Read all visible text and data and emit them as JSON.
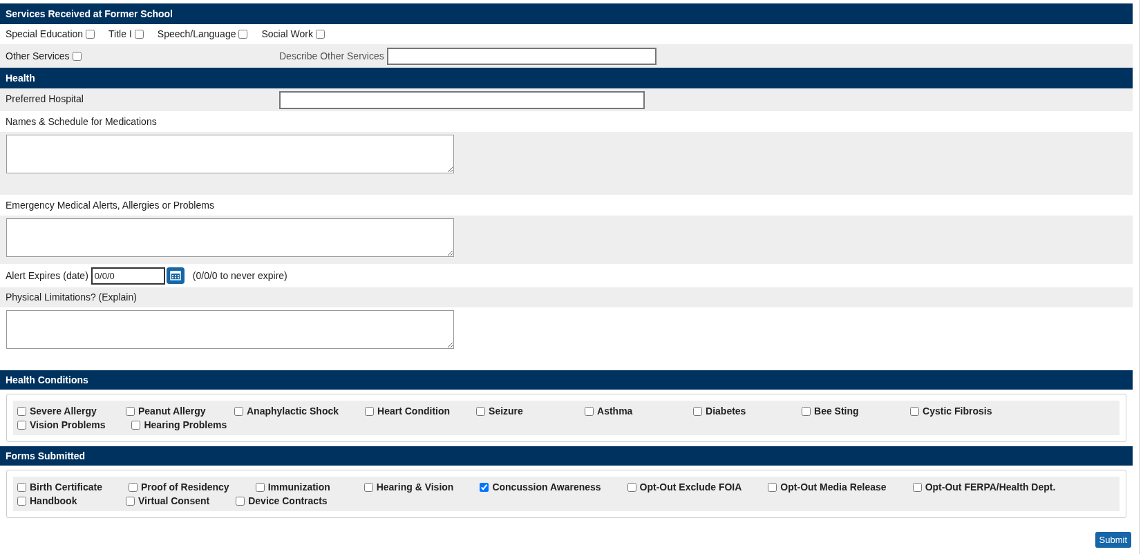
{
  "services": {
    "title": "Services Received at Former School",
    "options": [
      {
        "label": "Special Education",
        "checked": false
      },
      {
        "label": "Title I",
        "checked": false
      },
      {
        "label": "Speech/Language",
        "checked": false
      },
      {
        "label": "Social Work",
        "checked": false
      }
    ],
    "other": {
      "label": "Other Services",
      "checked": false
    },
    "describe_label": "Describe Other Services"
  },
  "health": {
    "title": "Health",
    "hospital_label": "Preferred Hospital",
    "medications_label": "Names & Schedule for Medications",
    "alerts_label": "Emergency Medical Alerts, Allergies or Problems",
    "alert_expires_label": "Alert Expires (date)",
    "alert_expires_value": "0/0/0",
    "alert_expires_hint": "(0/0/0 to never expire)",
    "physical_label": "Physical Limitations? (Explain)"
  },
  "health_conditions": {
    "title": "Health Conditions",
    "items": [
      {
        "label": "Severe Allergy",
        "checked": false
      },
      {
        "label": "Peanut Allergy",
        "checked": false
      },
      {
        "label": "Anaphylactic Shock",
        "checked": false
      },
      {
        "label": "Heart Condition",
        "checked": false
      },
      {
        "label": "Seizure",
        "checked": false
      },
      {
        "label": "Asthma",
        "checked": false
      },
      {
        "label": "Diabetes",
        "checked": false
      },
      {
        "label": "Bee Sting",
        "checked": false
      },
      {
        "label": "Cystic Fibrosis",
        "checked": false
      },
      {
        "label": "Vision Problems",
        "checked": false
      },
      {
        "label": "Hearing Problems",
        "checked": false
      }
    ]
  },
  "forms_submitted": {
    "title": "Forms Submitted",
    "items": [
      {
        "label": "Birth Certificate",
        "checked": false
      },
      {
        "label": "Proof of Residency",
        "checked": false
      },
      {
        "label": "Immunization",
        "checked": false
      },
      {
        "label": "Hearing & Vision",
        "checked": false
      },
      {
        "label": "Concussion Awareness",
        "checked": true
      },
      {
        "label": "Opt-Out Exclude FOIA",
        "checked": false
      },
      {
        "label": "Opt-Out Media Release",
        "checked": false
      },
      {
        "label": "Opt-Out FERPA/Health Dept.",
        "checked": false
      },
      {
        "label": "Handbook",
        "checked": false
      },
      {
        "label": "Virtual Consent",
        "checked": false
      },
      {
        "label": "Device Contracts",
        "checked": false
      }
    ]
  },
  "submit_button": "Submit"
}
